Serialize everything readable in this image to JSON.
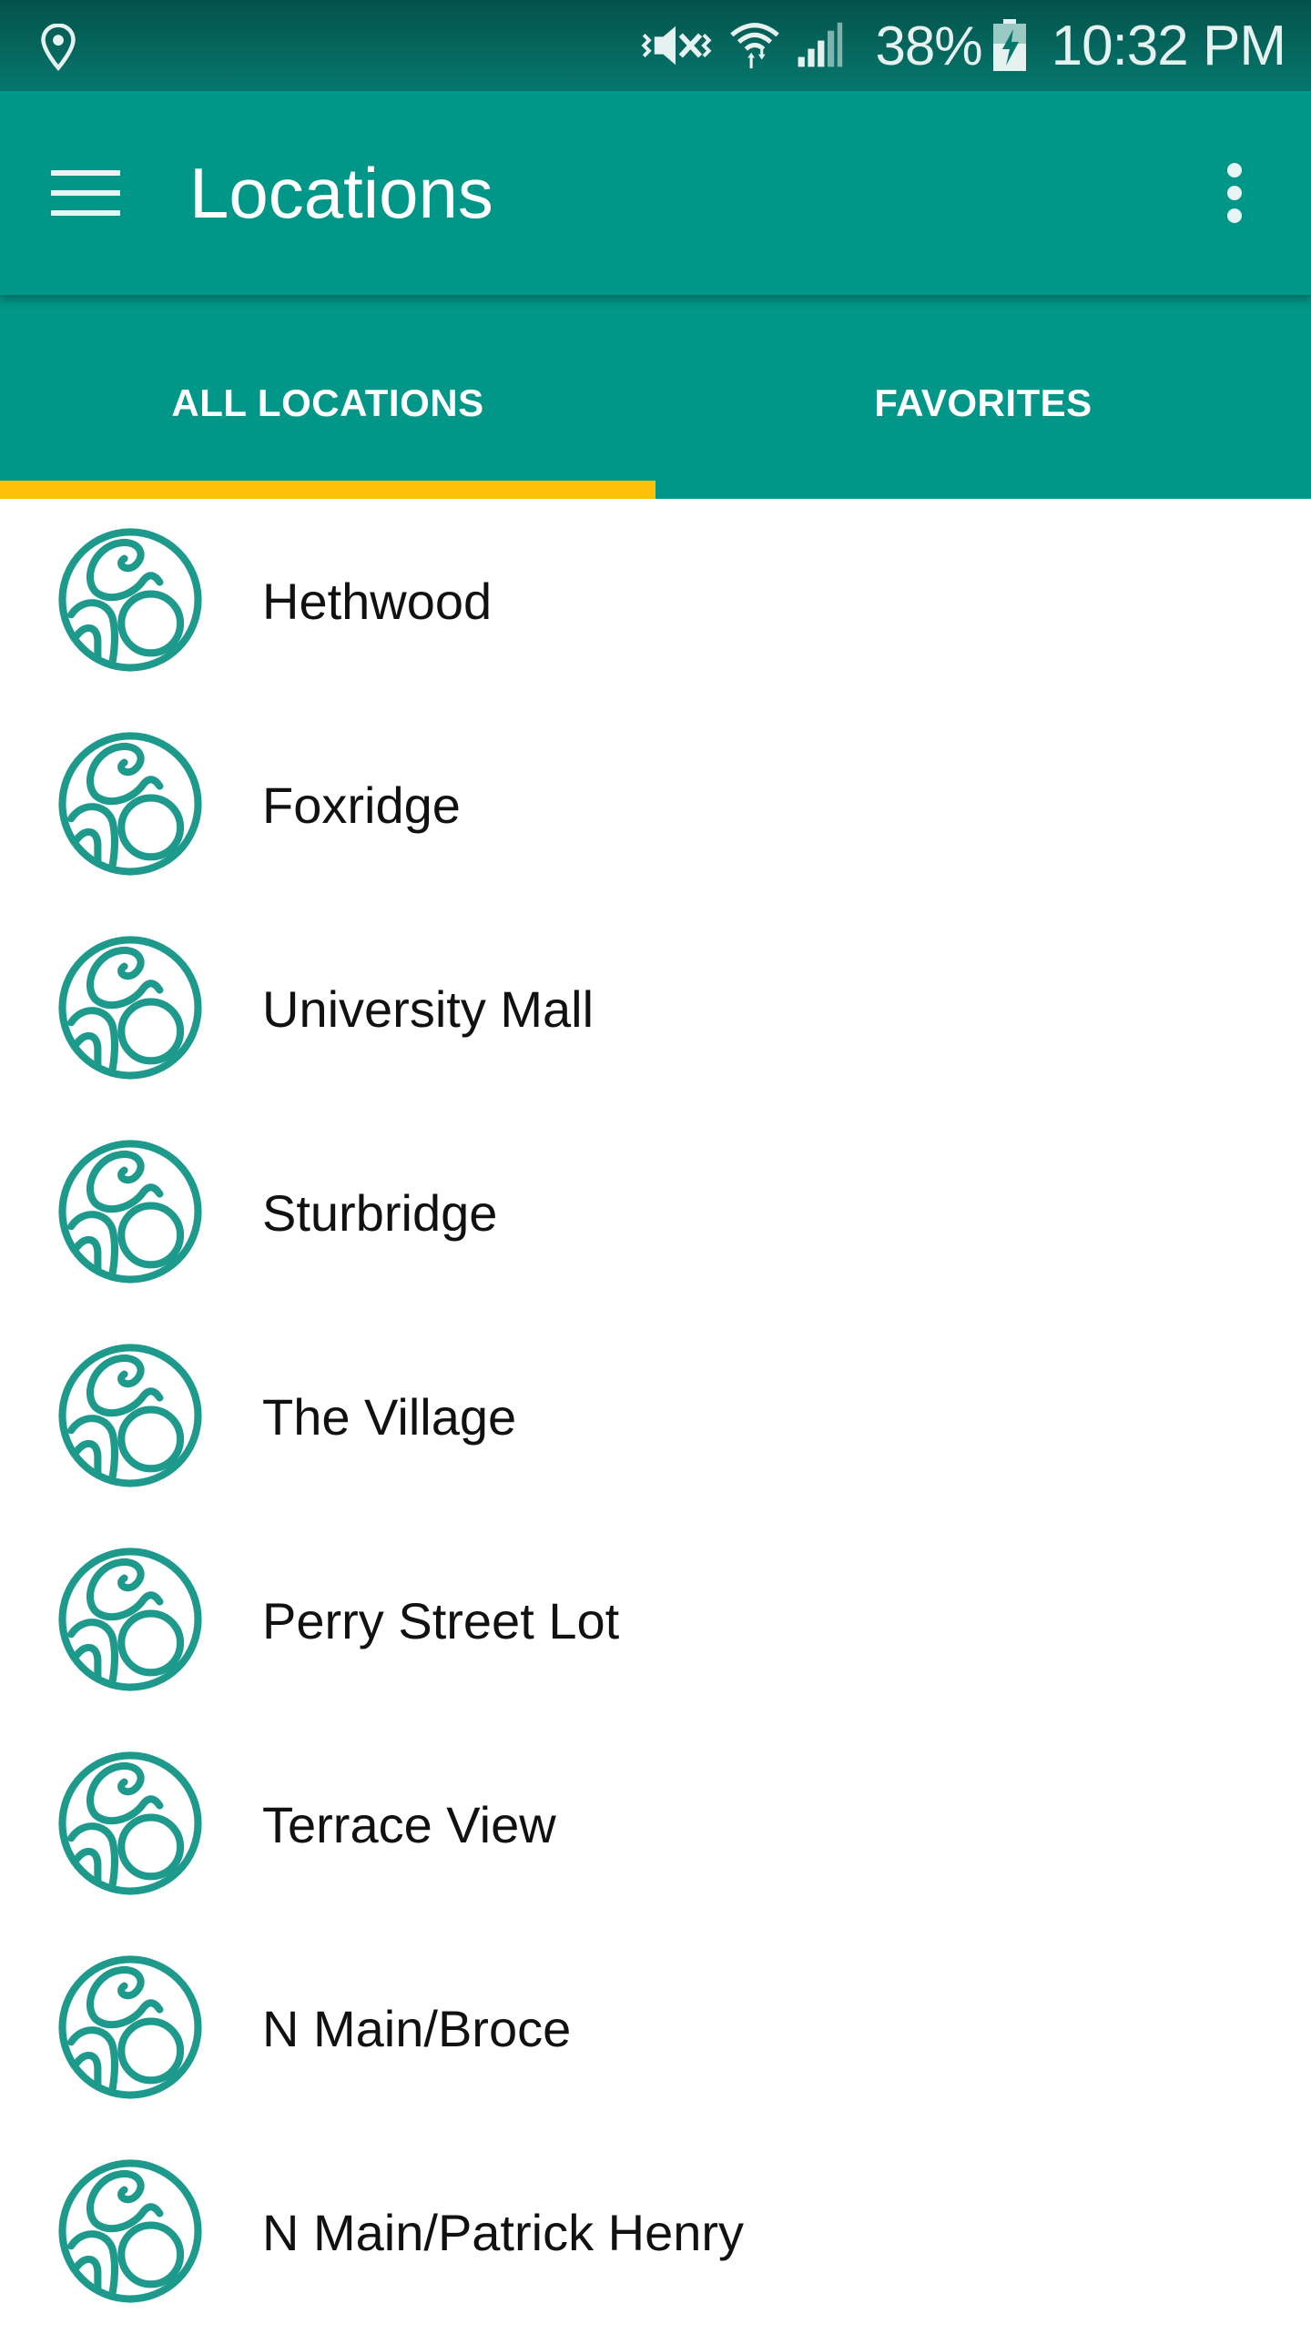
{
  "status_bar": {
    "battery_percent": "38%",
    "time": "10:32 PM",
    "icons": [
      "location-icon",
      "vibrate-mute-icon",
      "wifi-icon",
      "signal-icon",
      "battery-charging-icon"
    ]
  },
  "app_bar": {
    "title": "Locations",
    "menu_icon": "hamburger-menu-icon",
    "overflow_icon": "more-vert-icon"
  },
  "tabs": [
    {
      "label": "ALL LOCATIONS",
      "selected": true
    },
    {
      "label": "FAVORITES",
      "selected": false
    }
  ],
  "locations": [
    {
      "label": "Hethwood"
    },
    {
      "label": "Foxridge"
    },
    {
      "label": "University Mall"
    },
    {
      "label": "Sturbridge"
    },
    {
      "label": "The Village"
    },
    {
      "label": "Perry Street Lot"
    },
    {
      "label": "Terrace View"
    },
    {
      "label": "N Main/Broce"
    },
    {
      "label": "N Main/Patrick Henry"
    }
  ],
  "colors": {
    "primary": "#009688",
    "status_bar": "#06776d",
    "accent": "#ffc107",
    "avatar": "#1e9a8c",
    "text": "#111111"
  }
}
